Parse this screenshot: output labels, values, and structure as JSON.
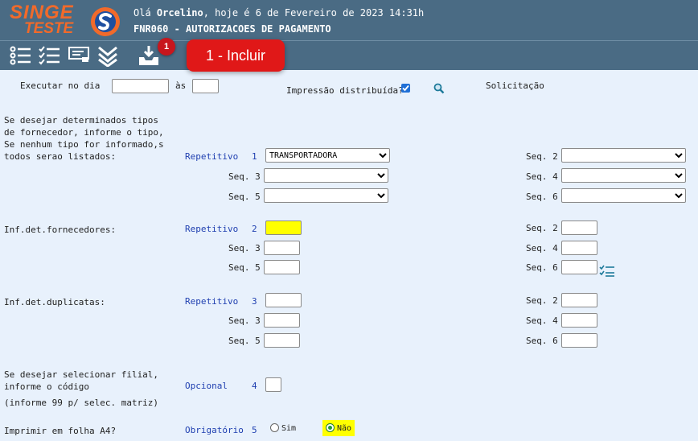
{
  "header": {
    "logo_top": "SINGE",
    "logo_bottom": "TESTE",
    "greeting_prefix": "Olá ",
    "user": "Orcelino",
    "greeting_suffix": ", hoje é 6 de Fevereiro de 2023 14:31h",
    "program_code": "FNR060",
    "program_title": " - AUTORIZACOES DE PAGAMENTO"
  },
  "toolbar": {
    "badge": "1",
    "callout": "1 - Incluir"
  },
  "form": {
    "executar_label": "Executar no dia",
    "as_label": "às",
    "impressao_label": "Impressão distribuída?",
    "solicitacao_label": "Solicitação",
    "tipos_text": [
      "Se desejar determinados tipos",
      "de fornecedor, informe o tipo,",
      "Se nenhum tipo for informado,s",
      "todos serao listados:"
    ],
    "tipos_status": "Repetitivo",
    "tipos_num": "1",
    "tipos_selected": "TRANSPORTADORA",
    "seq2": "Seq. 2",
    "seq3": "Seq. 3",
    "seq4": "Seq. 4",
    "seq5": "Seq. 5",
    "seq6": "Seq. 6",
    "fornecedores_label": "Inf.det.fornecedores:",
    "fornecedores_status": "Repetitivo",
    "fornecedores_num": "2",
    "duplicatas_label": "Inf.det.duplicatas:",
    "duplicatas_status": "Repetitivo",
    "duplicatas_num": "3",
    "filial_text": [
      "Se desejar selecionar filial,",
      "informe o código",
      "(informe 99 p/ selec. matriz)"
    ],
    "filial_status": "Opcional",
    "filial_num": "4",
    "a4_label": "Imprimir em folha A4?",
    "a4_status": "Obrigatório",
    "a4_num": "5",
    "a4_sim": "Sim",
    "a4_nao": "Não"
  },
  "colors": {
    "header_bg": "#4a6b84",
    "accent": "#f26a2a",
    "callout": "#e01818",
    "highlight": "#ffff00"
  }
}
